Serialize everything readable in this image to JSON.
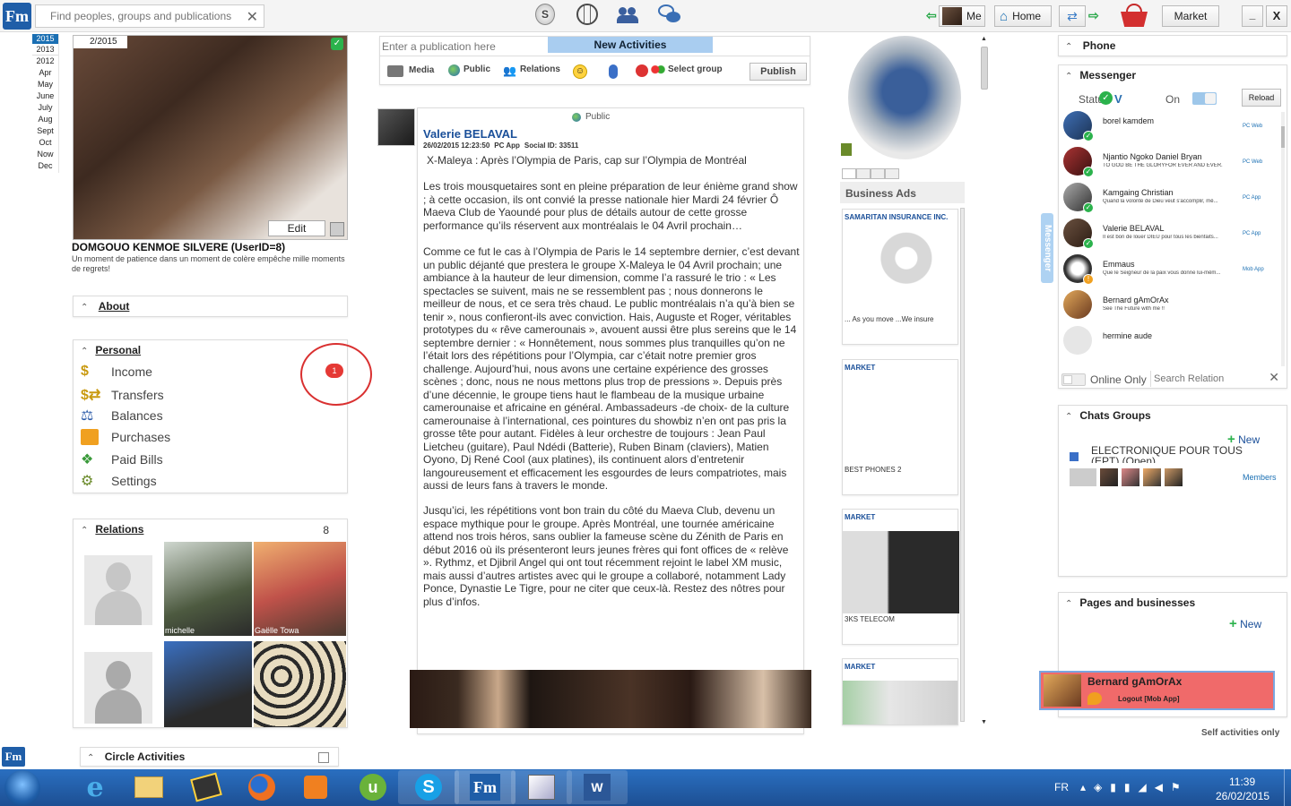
{
  "top": {
    "logo": "Fm",
    "search_placeholder": "Find peoples, groups and publications",
    "me_label": "Me",
    "home_label": "Home",
    "market_label": "Market",
    "minimize": "_",
    "close": "X"
  },
  "years": [
    "2015",
    "2013",
    "2012"
  ],
  "months": [
    "Apr",
    "May",
    "June",
    "July",
    "Aug",
    "Sept",
    "Oct",
    "Now",
    "Dec"
  ],
  "profile": {
    "date": "2/2015",
    "edit": "Edit",
    "name": "DOMGOUO KENMOE SILVERE (UserID=8)",
    "motto": "Un moment de patience dans un moment de colère empêche mille moments de regrets!"
  },
  "about_label": "About",
  "personal": {
    "title": "Personal",
    "items": [
      "Income",
      "Transfers",
      "Balances",
      "Purchases",
      "Paid Bills",
      "Settings"
    ],
    "badge": "1"
  },
  "relations": {
    "title": "Relations",
    "count": "8",
    "names": [
      "michelle",
      "Gaëlle Towa"
    ]
  },
  "circle": {
    "label": "Circle Activities"
  },
  "composer": {
    "placeholder": "Enter a publication here",
    "new_activities": "New Activities",
    "media": "Media",
    "public": "Public",
    "relations": "Relations",
    "select_group": "Select group",
    "publish": "Publish"
  },
  "post": {
    "visibility": "Public",
    "author": "Valerie BELAVAL",
    "meta_date": "26/02/2015 12:23:50",
    "meta_app": "PC App",
    "meta_social": "Social ID: 33511",
    "title": "X-Maleya : Après l’Olympia de Paris, cap sur l’Olympia de Montréal",
    "p1": "Les trois mousquetaires sont en pleine préparation de leur énième grand show ; à cette occasion, ils ont convié la presse nationale hier Mardi 24 février Ô Maeva Club de Yaoundé pour plus de détails autour de cette grosse performance qu’ils réservent aux montréalais le 04 Avril prochain…",
    "p2": "Comme ce fut le cas à l’Olympia de Paris le 14 septembre dernier, c’est devant un public déjanté que prestera le groupe X-Maleya le 04 Avril prochain; une ambiance à la hauteur de leur dimension, comme l’a rassuré le trio : « Les spectacles se suivent, mais ne se ressemblent pas ; nous donnerons le meilleur de nous, et ce sera très chaud. Le public montréalais n’a qu’à bien se tenir », nous confieront-ils avec conviction. Hais, Auguste et Roger, véritables prototypes du « rêve camerounais », avouent aussi être plus sereins que le 14 septembre dernier : « Honnêtement, nous sommes plus tranquilles qu’on ne l’était lors des répétitions pour l’Olympia, car c’était notre premier gros challenge. Aujourd’hui, nous avons une certaine expérience des grosses scènes ; donc, nous ne nous mettons plus trop de pressions ». Depuis près d’une décennie, le groupe tiens haut le flambeau de la musique urbaine camerounaise et africaine en général. Ambassadeurs -de choix- de la culture camerounaise à l’international, ces pointures du showbiz n’en ont pas pris la grosse tête pour autant. Fidèles à leur orchestre de toujours : Jean Paul Lietcheu (guitare), Paul Ndédi (Batterie), Ruben Binam (claviers), Matien Oyono, Dj René Cool (aux platines), ils continuent alors d’entretenir langoureusement et efficacement les esgourdes de leurs compatriotes, mais aussi de leurs fans à travers le monde.",
    "p3": "Jusqu’ici, les répétitions vont bon train du côté du Maeva Club, devenu un espace mythique pour le groupe. Après Montréal, une tournée américaine attend nos trois héros, sans oublier la fameuse scène du Zénith de Paris en début 2016 où ils présenteront leurs jeunes frères qui font offices de « relève ». Rythmz, et Djibril Angel qui ont tout récemment rejoint le label XM music, mais aussi d’autres artistes avec qui le groupe a collaboré, notamment Lady Ponce, Dynastie Le Tigre, pour ne citer que ceux-là. Restez des nôtres pour plus d’infos."
  },
  "ads": {
    "title": "Business Ads",
    "items": [
      {
        "head": "SAMARITAN INSURANCE INC.",
        "caption": "... As you move ...We insure"
      },
      {
        "head": "MARKET",
        "caption": "BEST PHONES 2"
      },
      {
        "head": "MARKET",
        "caption": "3KS TELECOM"
      },
      {
        "head": "MARKET",
        "caption": ""
      }
    ]
  },
  "messenger_tab": "Messenger",
  "phone": {
    "title": "Phone"
  },
  "messenger": {
    "title": "Messenger",
    "status_label": "Status",
    "on_label": "On",
    "reload": "Reload",
    "online_only": "Online Only",
    "search_placeholder": "Search Relation",
    "contacts": [
      {
        "name": "borel kamdem",
        "status": "",
        "device": "PC Web"
      },
      {
        "name": "Njantio Ngoko Daniel Bryan",
        "status": "TO GOD BE THE GLORYFOR EVER AND EVER.",
        "device": "PC Web"
      },
      {
        "name": "Kamgaing Christian",
        "status": "Quand la volonté de Dieu veut s'accomplir, mê...",
        "device": "PC App"
      },
      {
        "name": "Valerie BELAVAL",
        "status": "Il est bon de louer DIEU pour tous les bienfaits...",
        "device": "PC App"
      },
      {
        "name": "Emmaus",
        "status": "Que le Seigneur de la paix vous donne lui-mêm...",
        "device": "Mob App"
      },
      {
        "name": "Bernard gAmOrAx",
        "status": "See The Future with me !!",
        "device": ""
      },
      {
        "name": "hermine aude",
        "status": "",
        "device": ""
      }
    ]
  },
  "chats": {
    "title": "Chats Groups",
    "new": "New",
    "group_name": "ELECTRONIQUE POUR TOUS (EPT) (Open)",
    "members": "Members"
  },
  "pages": {
    "title": "Pages and businesses",
    "new": "New"
  },
  "toast": {
    "name": "Bernard gAmOrAx",
    "status": "Logout [Mob App]"
  },
  "self_activities": "Self activities only",
  "taskbar": {
    "lang": "FR",
    "time": "11:39",
    "date": "26/02/2015"
  },
  "colors": {
    "accent": "#1a6fb3",
    "toast": "#f06a6a",
    "badge": "#e53935",
    "taskbar": "#1d5fa8"
  }
}
